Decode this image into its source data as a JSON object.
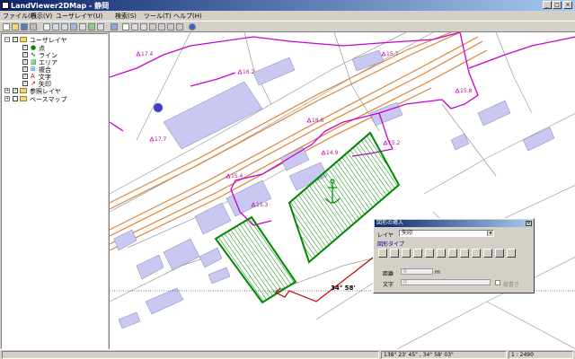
{
  "window": {
    "title": "LandViewer2DMap - 静岡",
    "controls": [
      "_",
      "□",
      "×"
    ]
  },
  "menubar": {
    "items": [
      "ファイル(F)",
      "表示(V)",
      "ユーザレイヤ(U)",
      "検索(S)",
      "ツール(T)",
      "ヘルプ(H)"
    ]
  },
  "tree": {
    "user_layer": "ユーザレイヤ",
    "children": [
      "点",
      "ライン",
      "エリア",
      "複合",
      "文字",
      "矢印"
    ],
    "ref_layer": "参照レイヤ",
    "base_map": "ベースマップ"
  },
  "map": {
    "labels": [
      "17.4",
      "16.2",
      "15.8",
      "17.7",
      "18.6",
      "15.7",
      "14.9",
      "15.2",
      "15.4",
      "15.3"
    ],
    "latitude_line_label": "34° 58'",
    "colors": {
      "boundary": "#cc00cc",
      "rail": "#e08030",
      "building": "#c8c8f0",
      "area": "#008800"
    }
  },
  "dialog": {
    "title": "図形の挿入",
    "layer_label": "レイヤ",
    "layer_value": "矢印",
    "shape_type_label": "図形タイプ",
    "distance_label": "距離",
    "distance_value": "0",
    "distance_unit": "m",
    "text_label": "文字",
    "text_value": "0",
    "vertical_label": "縦書き"
  },
  "status": {
    "coords": "138° 23' 45\" , 34° 58' 03\"",
    "scale": "1 : 2490"
  }
}
